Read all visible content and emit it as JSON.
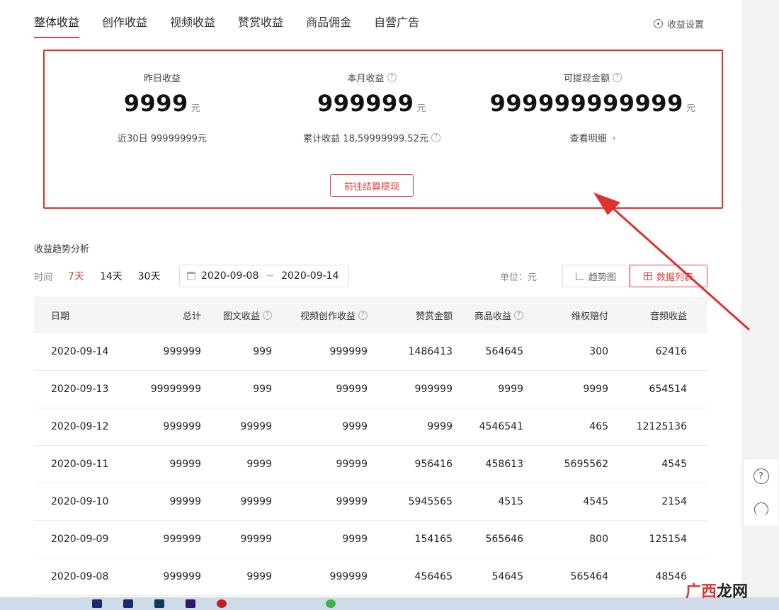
{
  "tabs": [
    {
      "label": "整体收益",
      "active": true
    },
    {
      "label": "创作收益",
      "active": false
    },
    {
      "label": "视频收益",
      "active": false
    },
    {
      "label": "赞赏收益",
      "active": false
    },
    {
      "label": "商品佣金",
      "active": false
    },
    {
      "label": "自营广告",
      "active": false
    }
  ],
  "settings_label": "收益设置",
  "summary": {
    "yesterday": {
      "label": "昨日收益",
      "value": "9999",
      "unit": "元",
      "sub": "近30日 99999999元"
    },
    "month": {
      "label": "本月收益",
      "value": "999999",
      "unit": "元",
      "sub": "累计收益 18,59999999.52元"
    },
    "withdrawable": {
      "label": "可提现金额",
      "value": "999999999999",
      "unit": "元",
      "sub": "查看明细"
    },
    "withdraw_button": "前往结算提现"
  },
  "trend": {
    "title": "收益趋势分析",
    "time_label": "时间",
    "ranges": [
      {
        "label": "7天",
        "active": true
      },
      {
        "label": "14天",
        "active": false
      },
      {
        "label": "30天",
        "active": false
      }
    ],
    "date_start": "2020-09-08",
    "date_sep": "~",
    "date_end": "2020-09-14",
    "unit_label": "单位：元",
    "view_trend": "趋势图",
    "view_list": "数据列表"
  },
  "table": {
    "headers": [
      "日期",
      "总计",
      "图文收益",
      "视频创作收益",
      "赞赏金额",
      "商品收益",
      "维权赔付",
      "音频收益"
    ],
    "rows": [
      [
        "2020-09-14",
        "999999",
        "999",
        "999999",
        "1486413",
        "564645",
        "300",
        "62416"
      ],
      [
        "2020-09-13",
        "99999999",
        "999",
        "99999",
        "999999",
        "9999",
        "9999",
        "654514"
      ],
      [
        "2020-09-12",
        "999999",
        "99999",
        "9999",
        "9999",
        "4546541",
        "465",
        "12125136"
      ],
      [
        "2020-09-11",
        "99999",
        "9999",
        "99999",
        "956416",
        "458613",
        "5695562",
        "4545"
      ],
      [
        "2020-09-10",
        "99999",
        "99999",
        "99999",
        "5945565",
        "4515",
        "4545",
        "2154"
      ],
      [
        "2020-09-09",
        "999999",
        "99999",
        "9999",
        "154165",
        "565646",
        "800",
        "125154"
      ],
      [
        "2020-09-08",
        "999999",
        "9999",
        "999999",
        "456465",
        "54645",
        "565464",
        "48546"
      ]
    ]
  },
  "float": {
    "help_glyph": "?"
  },
  "watermark": {
    "part1": "广西",
    "part2": "龙网"
  },
  "colors": {
    "accent": "#e0403f",
    "annotation": "#e0302f"
  }
}
